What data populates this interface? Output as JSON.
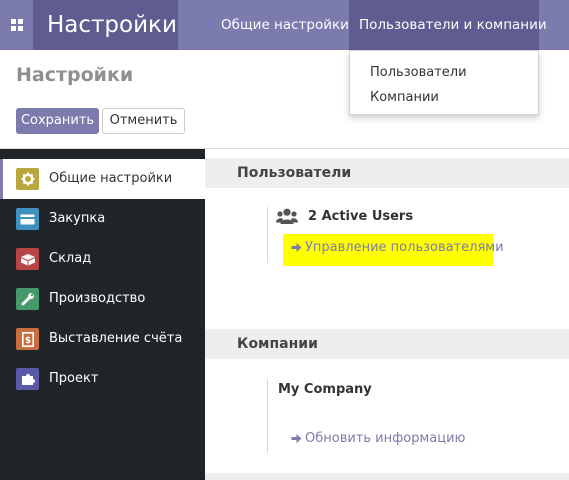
{
  "navbar": {
    "apps_icon": "apps-grid-icon",
    "brand": "Настройки",
    "items": [
      "Общие настройки",
      "Пользователи и компании"
    ]
  },
  "dropdown": {
    "items": [
      "Пользователи",
      "Компании"
    ]
  },
  "control_panel": {
    "title": "Настройки",
    "save_label": "Сохранить",
    "cancel_label": "Отменить"
  },
  "sidebar": {
    "items": [
      {
        "label": "Общие настройки",
        "icon": "gear-icon",
        "color": "#b8a83f",
        "active": true
      },
      {
        "label": "Закупка",
        "icon": "credit-card-icon",
        "color": "#3f8fbf"
      },
      {
        "label": "Склад",
        "icon": "box-icon",
        "color": "#b84545"
      },
      {
        "label": "Производство",
        "icon": "wrench-icon",
        "color": "#45996a"
      },
      {
        "label": "Выставление счёта",
        "icon": "invoice-icon",
        "color": "#c86d3f"
      },
      {
        "label": "Проект",
        "icon": "puzzle-icon",
        "color": "#5a5aa8"
      }
    ]
  },
  "content": {
    "users_section": {
      "title": "Пользователи",
      "active_users": "2 Active Users",
      "manage_link": "Управление пользователями"
    },
    "companies_section": {
      "title": "Компании",
      "company_name": "My Company",
      "update_link": "Обновить информацию"
    }
  },
  "colors": {
    "primary": "#7c7bad",
    "primary_dark": "#5e5c90",
    "sidebar_bg": "#212529",
    "highlight": "#ffff00"
  }
}
